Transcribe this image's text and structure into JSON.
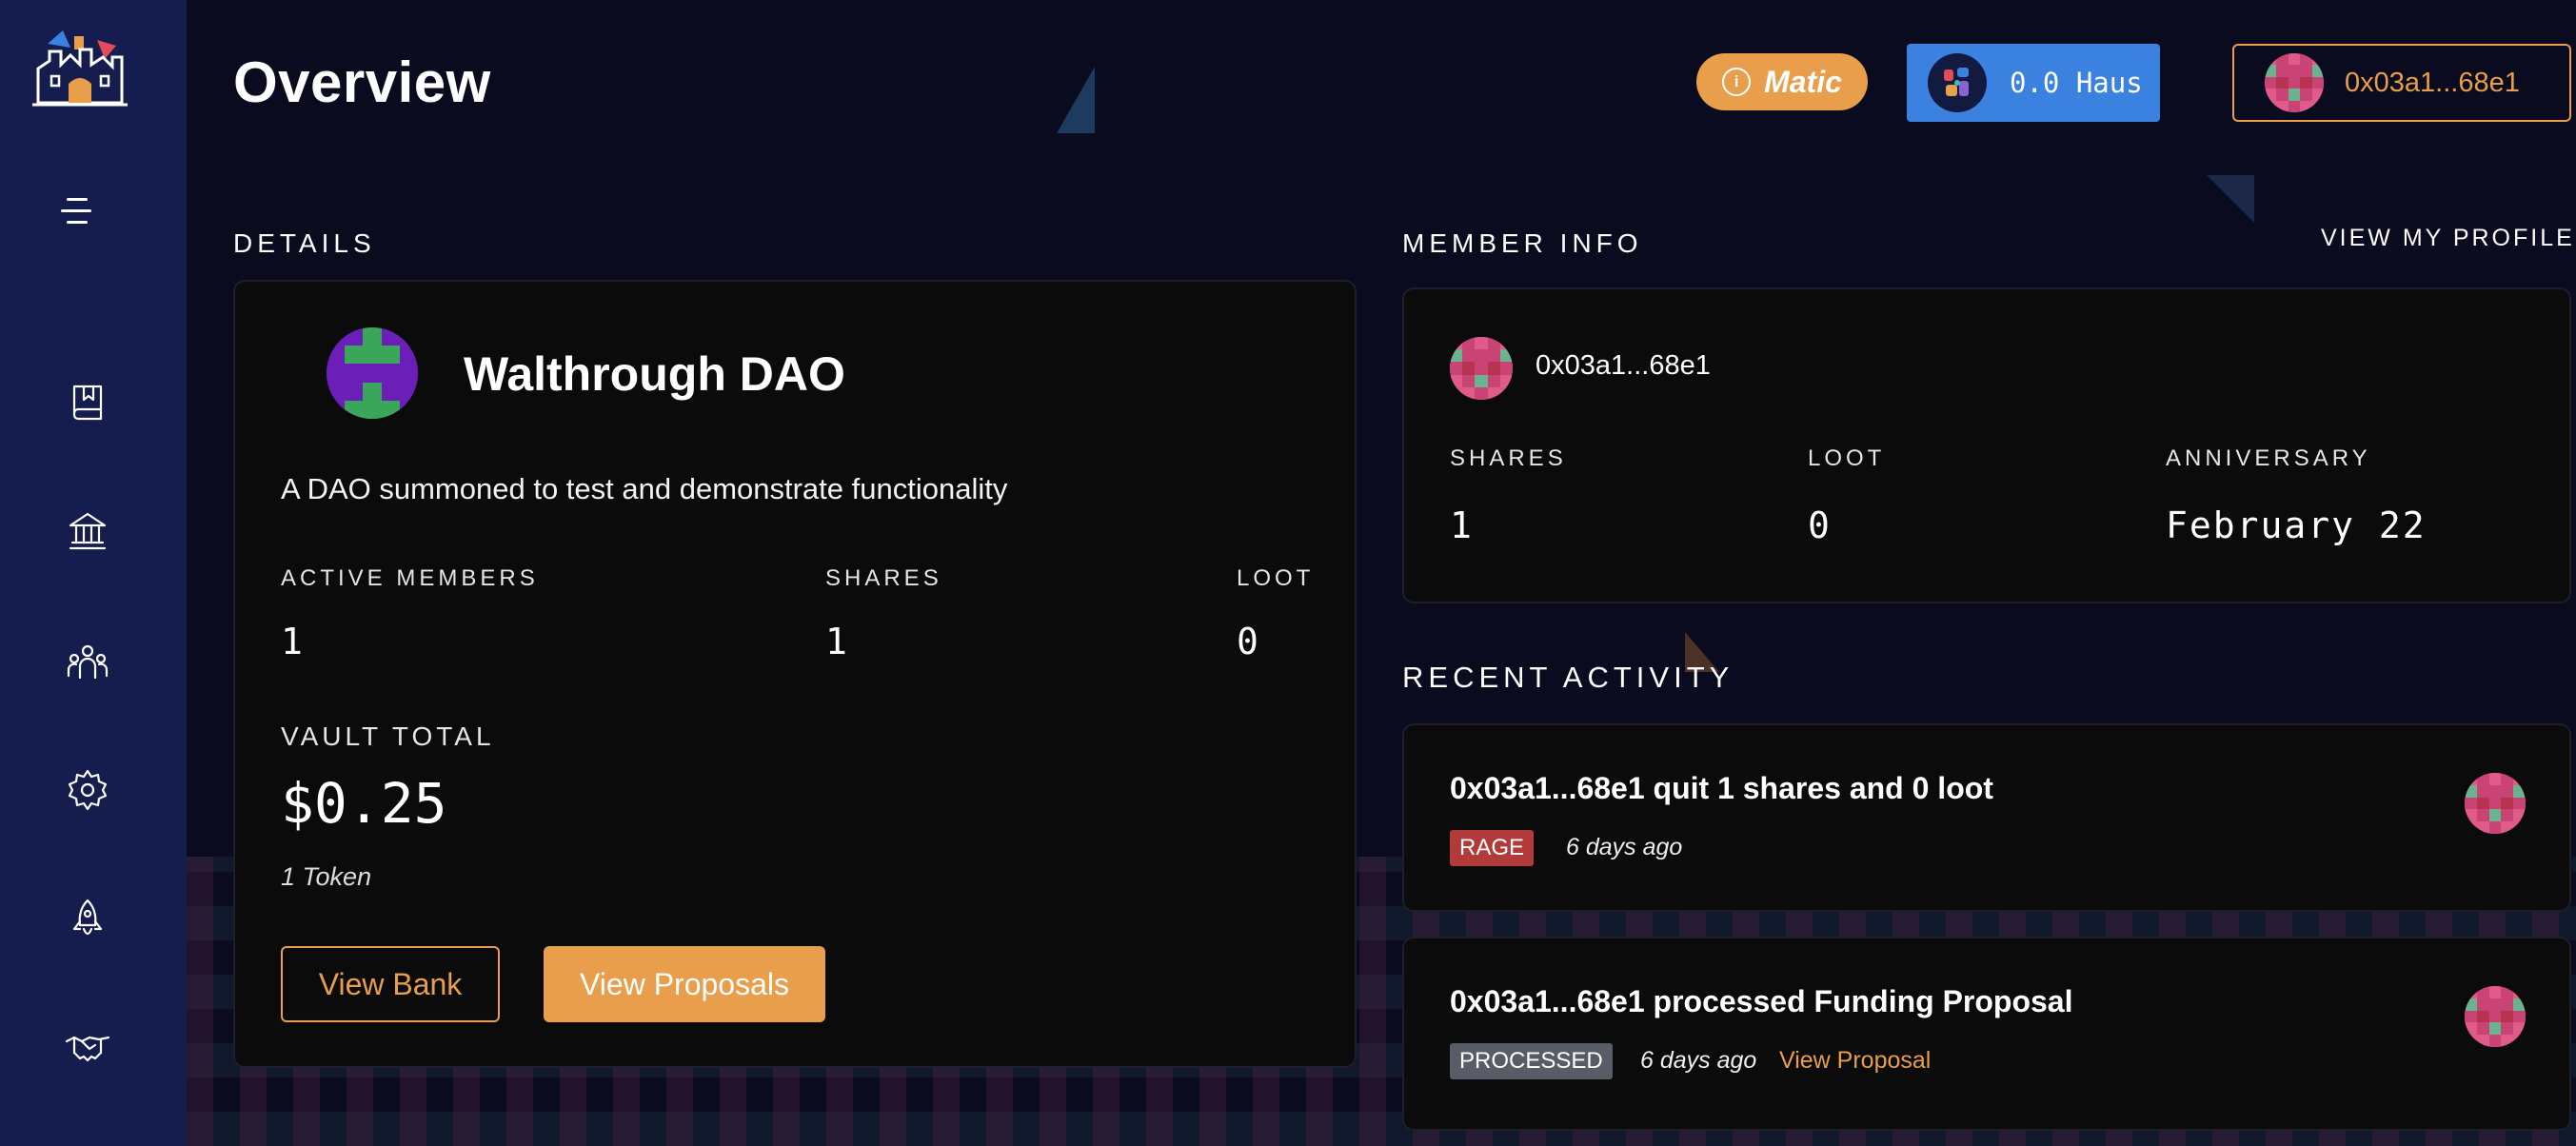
{
  "header": {
    "title": "Overview",
    "network": "Matic",
    "haus_balance": "0.0 Haus",
    "account": "0x03a1...68e1"
  },
  "details": {
    "section_label": "DETAILS",
    "dao_name": "Walthrough DAO",
    "description": "A DAO summoned to test and demonstrate functionality",
    "stats": [
      {
        "label": "ACTIVE MEMBERS",
        "value": "1"
      },
      {
        "label": "SHARES",
        "value": "1"
      },
      {
        "label": "LOOT",
        "value": "0"
      }
    ],
    "vault_label": "VAULT TOTAL",
    "vault_total": "$0.25",
    "token_count": "1 Token",
    "view_bank_label": "View Bank",
    "view_proposals_label": "View Proposals"
  },
  "member_info": {
    "section_label": "MEMBER INFO",
    "view_profile_label": "VIEW MY PROFILE",
    "address": "0x03a1...68e1",
    "stats": [
      {
        "label": "SHARES",
        "value": "1"
      },
      {
        "label": "LOOT",
        "value": "0"
      },
      {
        "label": "ANNIVERSARY",
        "value": "February 22"
      }
    ]
  },
  "recent_activity": {
    "section_label": "RECENT ACTIVITY",
    "items": [
      {
        "title": "0x03a1...68e1 quit 1 shares and 0 loot",
        "tag": "RAGE",
        "time": "6 days ago",
        "link": ""
      },
      {
        "title": "0x03a1...68e1 processed Funding Proposal",
        "tag": "PROCESSED",
        "time": "6 days ago",
        "link": "View Proposal"
      }
    ]
  },
  "colors": {
    "background": "#0a0b1f",
    "sidebar": "#151c4e",
    "accent": "#e89e4a",
    "haus_button": "#3b82e0",
    "card": "#0b0b0c",
    "rage_tag": "#b23a38",
    "processed_tag": "#575c66"
  },
  "sidebar": {
    "icons": [
      "dao-castle-logo",
      "menu-icon",
      "book-icon",
      "bank-icon",
      "members-icon",
      "gear-icon",
      "rocket-icon",
      "handshake-icon"
    ]
  }
}
